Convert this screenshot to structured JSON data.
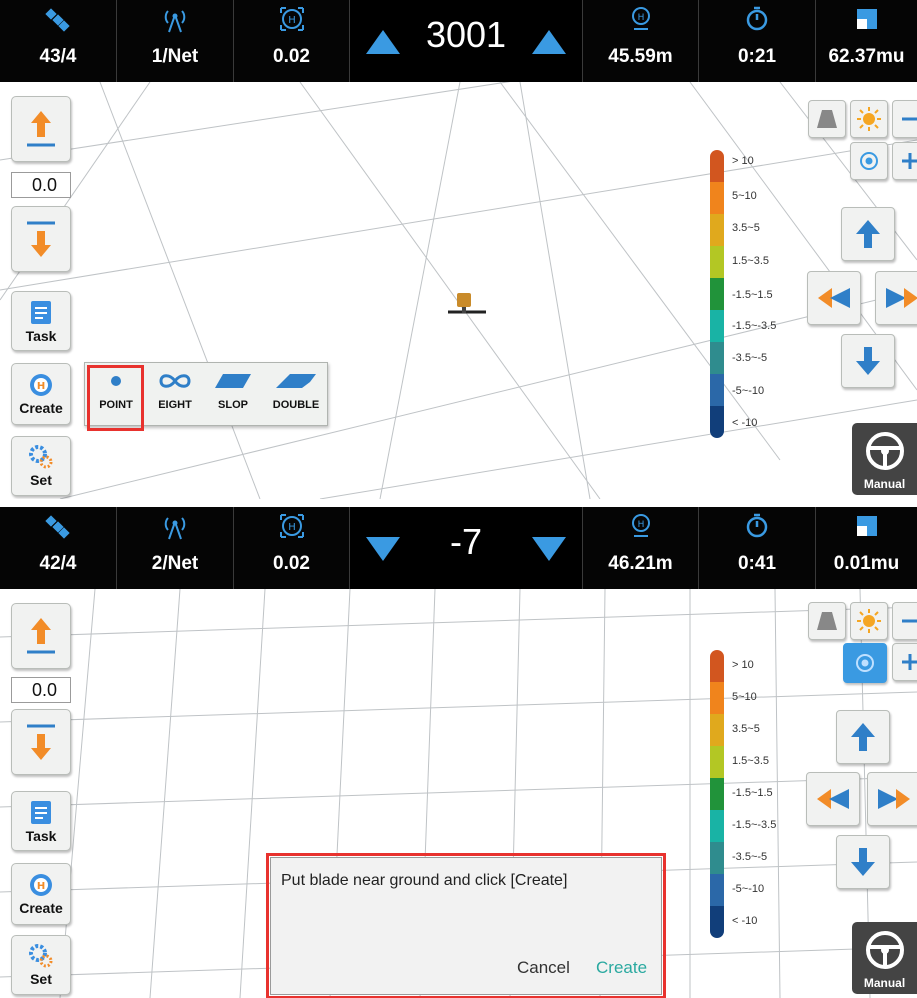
{
  "panels": [
    {
      "status": {
        "satellites": "43/4",
        "network": "1/Net",
        "precision": "0.02",
        "center_value": "3001",
        "arrow_direction": "up",
        "distance": "45.59m",
        "time": "0:21",
        "area": "62.37mu"
      },
      "left": {
        "offset_value": "0.0",
        "task_label": "Task",
        "create_label": "Create",
        "set_label": "Set"
      },
      "create_menu": {
        "items": [
          {
            "label": "POINT",
            "icon": "point-icon",
            "selected": true
          },
          {
            "label": "EIGHT",
            "icon": "infinity-icon"
          },
          {
            "label": "SLOP",
            "icon": "slope-icon"
          },
          {
            "label": "DOUBLE",
            "icon": "double-slope-icon"
          }
        ]
      },
      "legend": [
        "> 10",
        "5~10",
        "3.5~5",
        "1.5~3.5",
        "-1.5~1.5",
        "-1.5~-3.5",
        "-3.5~-5",
        "-5~-10",
        "< -10"
      ],
      "manual_label": "Manual"
    },
    {
      "status": {
        "satellites": "42/4",
        "network": "2/Net",
        "precision": "0.02",
        "center_value": "-7",
        "arrow_direction": "down",
        "distance": "46.21m",
        "time": "0:41",
        "area": "0.01mu"
      },
      "left": {
        "offset_value": "0.0",
        "task_label": "Task",
        "create_label": "Create",
        "set_label": "Set"
      },
      "dialog": {
        "message": "Put blade near ground and click [Create]",
        "cancel_label": "Cancel",
        "create_label": "Create"
      },
      "legend": [
        "> 10",
        "5~10",
        "3.5~5",
        "1.5~3.5",
        "-1.5~1.5",
        "-1.5~-3.5",
        "-3.5~-5",
        "-5~-10",
        "< -10"
      ],
      "manual_label": "Manual"
    }
  ],
  "colors": {
    "legend": [
      "#d2561f",
      "#f0841c",
      "#e0a91d",
      "#b3c724",
      "#21933a",
      "#19b3a5",
      "#2f8c8e",
      "#2b68a8",
      "#113e7a"
    ],
    "accent_blue": "#3a9ae2",
    "highlight_red": "#e8322e",
    "create_text": "#2aa9a0"
  }
}
